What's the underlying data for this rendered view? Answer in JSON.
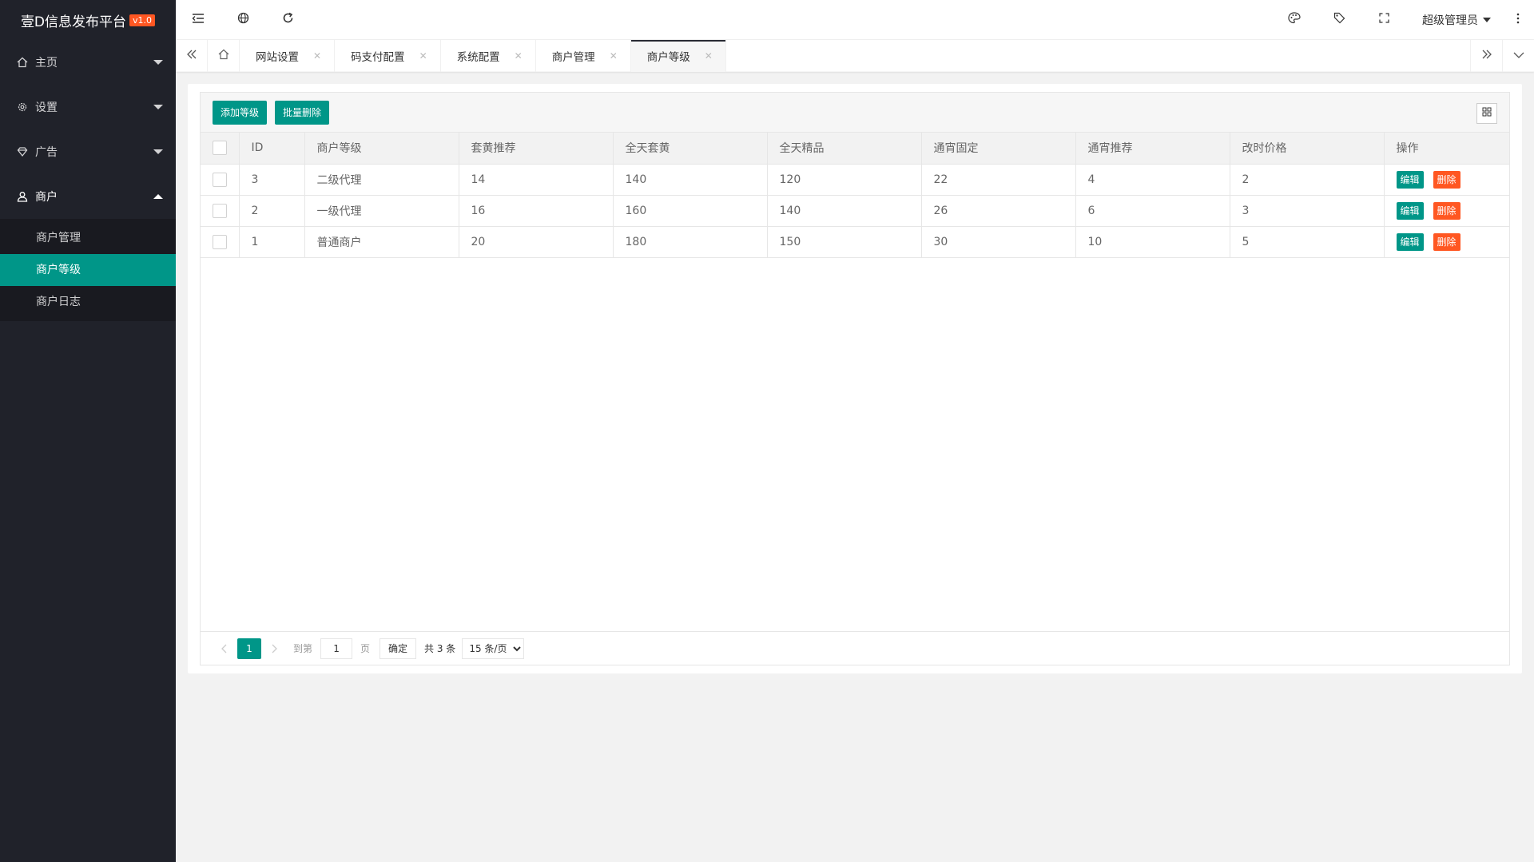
{
  "app": {
    "title": "壹D信息发布平台",
    "version": "v1.0"
  },
  "sidebar": {
    "items": [
      {
        "label": "主页",
        "icon": "home-icon"
      },
      {
        "label": "设置",
        "icon": "gear-icon"
      },
      {
        "label": "广告",
        "icon": "diamond-icon"
      },
      {
        "label": "商户",
        "icon": "user-icon"
      }
    ],
    "sub_items": [
      {
        "label": "商户管理"
      },
      {
        "label": "商户等级"
      },
      {
        "label": "商户日志"
      }
    ]
  },
  "header": {
    "user": "超级管理员"
  },
  "tabs": [
    {
      "label": "网站设置"
    },
    {
      "label": "码支付配置"
    },
    {
      "label": "系统配置"
    },
    {
      "label": "商户管理"
    },
    {
      "label": "商户等级"
    }
  ],
  "toolbar": {
    "add_label": "添加等级",
    "batch_delete_label": "批量删除"
  },
  "table": {
    "headers": [
      "ID",
      "商户等级",
      "套黄推荐",
      "全天套黄",
      "全天精品",
      "通宵固定",
      "通宵推荐",
      "改时价格",
      "操作"
    ],
    "rows": [
      [
        "3",
        "二级代理",
        "14",
        "140",
        "120",
        "22",
        "4",
        "2"
      ],
      [
        "2",
        "一级代理",
        "16",
        "160",
        "140",
        "26",
        "6",
        "3"
      ],
      [
        "1",
        "普通商户",
        "20",
        "180",
        "150",
        "30",
        "10",
        "5"
      ]
    ],
    "edit_label": "编辑",
    "delete_label": "删除"
  },
  "pager": {
    "current": "1",
    "goto_label": "到第",
    "page_value": "1",
    "page_unit": "页",
    "ok_label": "确定",
    "total": "共 3 条",
    "page_size": "15 条/页"
  },
  "colors": {
    "primary": "#009688",
    "danger": "#ff5722",
    "sidebar": "#20222a"
  }
}
